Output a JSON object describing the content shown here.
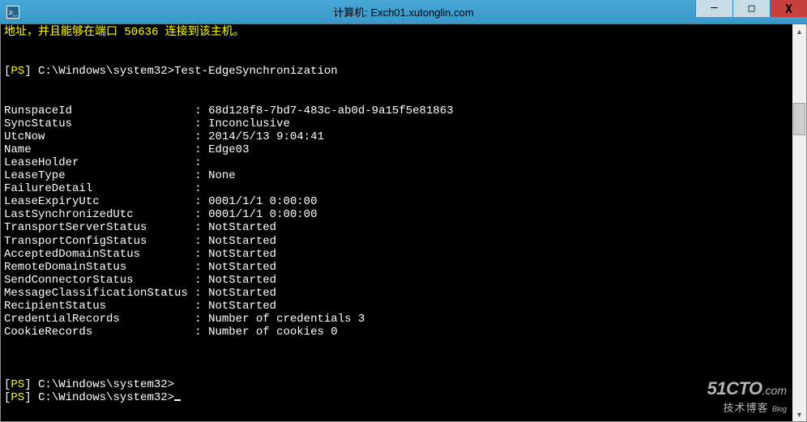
{
  "titlebar": {
    "icon_label": "≥_",
    "title": "计算机: Exch01.xutonglin.com",
    "min": "─",
    "max": "□",
    "close": "X"
  },
  "terminal": {
    "line_top": "地址，并且能够在端口 50636 连接到该主机。",
    "prompt_open": "[",
    "prompt_ps": "PS",
    "prompt_close": "]",
    "prompt_path": " C:\\Windows\\system32>",
    "command1": "Test-EdgeSynchronization",
    "fields": [
      [
        "RunspaceId                 ",
        "68d128f8-7bd7-483c-ab0d-9a15f5e81863"
      ],
      [
        "SyncStatus                 ",
        "Inconclusive"
      ],
      [
        "UtcNow                     ",
        "2014/5/13 9:04:41"
      ],
      [
        "Name                       ",
        "Edge03"
      ],
      [
        "LeaseHolder                ",
        ""
      ],
      [
        "LeaseType                  ",
        "None"
      ],
      [
        "FailureDetail              ",
        ""
      ],
      [
        "LeaseExpiryUtc             ",
        "0001/1/1 0:00:00"
      ],
      [
        "LastSynchronizedUtc        ",
        "0001/1/1 0:00:00"
      ],
      [
        "TransportServerStatus      ",
        "NotStarted"
      ],
      [
        "TransportConfigStatus      ",
        "NotStarted"
      ],
      [
        "AcceptedDomainStatus       ",
        "NotStarted"
      ],
      [
        "RemoteDomainStatus         ",
        "NotStarted"
      ],
      [
        "SendConnectorStatus        ",
        "NotStarted"
      ],
      [
        "MessageClassificationStatus",
        "NotStarted"
      ],
      [
        "RecipientStatus            ",
        "NotStarted"
      ],
      [
        "CredentialRecords          ",
        "Number of credentials 3"
      ],
      [
        "CookieRecords              ",
        "Number of cookies 0"
      ]
    ]
  },
  "scroll": {
    "up": "▲",
    "down": "▼"
  },
  "watermark": {
    "main": "51CTO",
    "dotcom": ".com",
    "sub": "技术博客",
    "blog": "Blog"
  }
}
